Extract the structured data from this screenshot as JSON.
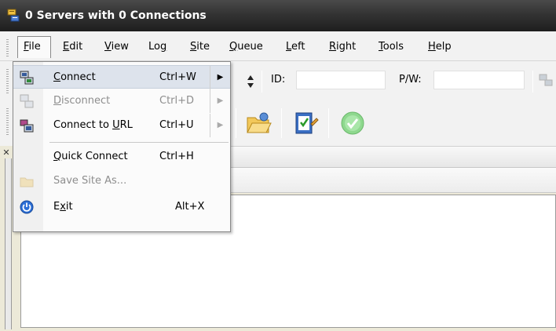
{
  "window": {
    "title": "0 Servers with 0 Connections"
  },
  "menubar": {
    "items": [
      {
        "pre": "",
        "key": "F",
        "post": "ile"
      },
      {
        "pre": "",
        "key": "E",
        "post": "dit"
      },
      {
        "pre": "",
        "key": "V",
        "post": "iew"
      },
      {
        "pre": "Lo",
        "key": "g",
        "post": ""
      },
      {
        "pre": "",
        "key": "S",
        "post": "ite"
      },
      {
        "pre": "",
        "key": "Q",
        "post": "ueue"
      },
      {
        "pre": "",
        "key": "L",
        "post": "eft"
      },
      {
        "pre": "",
        "key": "R",
        "post": "ight"
      },
      {
        "pre": "",
        "key": "T",
        "post": "ools"
      },
      {
        "pre": "",
        "key": "H",
        "post": "elp"
      }
    ]
  },
  "toolbar": {
    "id_label": "ID:",
    "pw_label": "P/W:",
    "id_value": "",
    "pw_value": ""
  },
  "file_menu": {
    "items": [
      {
        "pre": "",
        "key": "C",
        "post": "onnect",
        "shortcut": "Ctrl+W",
        "submenu": true,
        "enabled": true,
        "highlighted": true,
        "icon": "connect-icon"
      },
      {
        "pre": "",
        "key": "D",
        "post": "isconnect",
        "shortcut": "Ctrl+D",
        "submenu": true,
        "enabled": false,
        "highlighted": false,
        "icon": "disconnect-icon"
      },
      {
        "pre": "Connect to ",
        "key": "U",
        "post": "RL",
        "shortcut": "Ctrl+U",
        "submenu": true,
        "enabled": true,
        "highlighted": false,
        "icon": "connect-url-icon"
      },
      {
        "pre": "",
        "key": "Q",
        "post": "uick Connect",
        "shortcut": "Ctrl+H",
        "submenu": false,
        "enabled": true,
        "highlighted": false,
        "icon": ""
      },
      {
        "pre": "Save Site As...",
        "key": "",
        "post": "",
        "shortcut": "",
        "submenu": false,
        "enabled": false,
        "highlighted": false,
        "icon": "folder-icon"
      },
      {
        "pre": "E",
        "key": "x",
        "post": "it",
        "shortcut": "Alt+X",
        "submenu": false,
        "enabled": true,
        "highlighted": false,
        "icon": "power-icon"
      }
    ]
  },
  "colors": {
    "titlebar": "#333333",
    "menu_highlight": "#dde3ec",
    "disabled_text": "#8e8e8e"
  }
}
